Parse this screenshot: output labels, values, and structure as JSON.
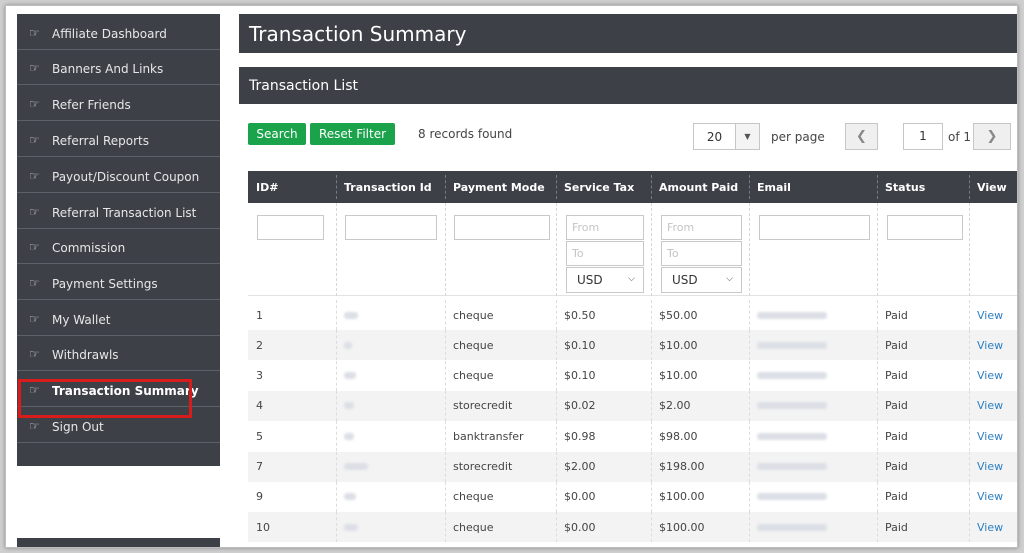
{
  "sidebar": {
    "items": [
      {
        "label": "Affiliate Dashboard"
      },
      {
        "label": "Banners And Links"
      },
      {
        "label": "Refer Friends"
      },
      {
        "label": "Referral Reports"
      },
      {
        "label": "Payout/Discount Coupon"
      },
      {
        "label": "Referral Transaction List"
      },
      {
        "label": "Commission"
      },
      {
        "label": "Payment Settings"
      },
      {
        "label": "My Wallet"
      },
      {
        "label": "Withdrawls"
      },
      {
        "label": "Transaction Summary"
      },
      {
        "label": "Sign Out"
      }
    ],
    "active_item": "Transaction Summary",
    "icon": "pointing-hand-icon"
  },
  "page": {
    "title": "Transaction Summary",
    "section_title": "Transaction List"
  },
  "toolbar": {
    "search_label": "Search",
    "reset_label": "Reset Filter",
    "records_text": "8 records found",
    "per_page_value": "20",
    "per_page_label": "per page",
    "prev_icon": "❮",
    "next_icon": "❯",
    "page_value": "1",
    "of_label": "of 1"
  },
  "table": {
    "columns": [
      "ID#",
      "Transaction Id",
      "Payment Mode",
      "Service Tax",
      "Amount Paid",
      "Email",
      "Status",
      "View"
    ],
    "filters": {
      "from_placeholder": "From",
      "to_placeholder": "To",
      "currency": "USD"
    },
    "rows": [
      {
        "id": "1",
        "mode": "cheque",
        "tax": "$0.50",
        "amount": "$50.00",
        "status": "Paid",
        "view": "View"
      },
      {
        "id": "2",
        "mode": "cheque",
        "tax": "$0.10",
        "amount": "$10.00",
        "status": "Paid",
        "view": "View"
      },
      {
        "id": "3",
        "mode": "cheque",
        "tax": "$0.10",
        "amount": "$10.00",
        "status": "Paid",
        "view": "View"
      },
      {
        "id": "4",
        "mode": "storecredit",
        "tax": "$0.02",
        "amount": "$2.00",
        "status": "Paid",
        "view": "View"
      },
      {
        "id": "5",
        "mode": "banktransfer",
        "tax": "$0.98",
        "amount": "$98.00",
        "status": "Paid",
        "view": "View"
      },
      {
        "id": "7",
        "mode": "storecredit",
        "tax": "$2.00",
        "amount": "$198.00",
        "status": "Paid",
        "view": "View"
      },
      {
        "id": "9",
        "mode": "cheque",
        "tax": "$0.00",
        "amount": "$100.00",
        "status": "Paid",
        "view": "View"
      },
      {
        "id": "10",
        "mode": "cheque",
        "tax": "$0.00",
        "amount": "$100.00",
        "status": "Paid",
        "view": "View"
      }
    ]
  },
  "colors": {
    "dark_bar": "#3e4048",
    "green": "#1aa34a",
    "active_outline": "#d81c1c",
    "link": "#2d7fc1"
  }
}
